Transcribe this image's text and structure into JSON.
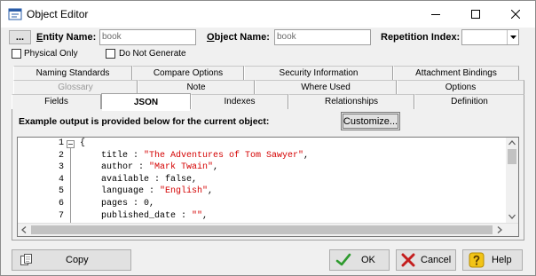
{
  "window": {
    "title": "Object Editor",
    "minimize_icon": "minimize-icon",
    "maximize_icon": "maximize-icon",
    "close_icon": "close-icon"
  },
  "header": {
    "ellipsis_label": "...",
    "entity_label": "Entity Name:",
    "entity_value": "book",
    "object_label": "Object Name:",
    "object_value": "book",
    "repetition_label": "Repetition Index:",
    "repetition_value": "",
    "physical_only_label": "Physical Only",
    "physical_only_checked": false,
    "do_not_generate_label": "Do Not Generate",
    "do_not_generate_checked": false
  },
  "tabs": {
    "row1": [
      "Naming Standards",
      "Compare Options",
      "Security Information",
      "Attachment Bindings"
    ],
    "row2": [
      "Glossary",
      "Note",
      "Where Used",
      "Options"
    ],
    "row3": [
      "Fields",
      "JSON",
      "Indexes",
      "Relationships",
      "Definition"
    ],
    "active": "JSON",
    "disabled": [
      "Glossary"
    ]
  },
  "json_panel": {
    "description": "Example output is provided below for the current object:",
    "customize_label": "Customize...",
    "line_numbers": [
      "1",
      "2",
      "3",
      "4",
      "5",
      "6",
      "7"
    ],
    "lines": [
      {
        "pre": "{",
        "str": "",
        "post": ""
      },
      {
        "pre": "    title : ",
        "str": "\"The Adventures of Tom Sawyer\"",
        "post": ","
      },
      {
        "pre": "    author : ",
        "str": "\"Mark Twain\"",
        "post": ","
      },
      {
        "pre": "    available : false,",
        "str": "",
        "post": ""
      },
      {
        "pre": "    language : ",
        "str": "\"English\"",
        "post": ","
      },
      {
        "pre": "    pages : 0,",
        "str": "",
        "post": ""
      },
      {
        "pre": "    published_date : ",
        "str": "\"\"",
        "post": ","
      }
    ]
  },
  "footer": {
    "copy_label": "Copy",
    "ok_label": "OK",
    "cancel_label": "Cancel",
    "help_label": "Help"
  }
}
